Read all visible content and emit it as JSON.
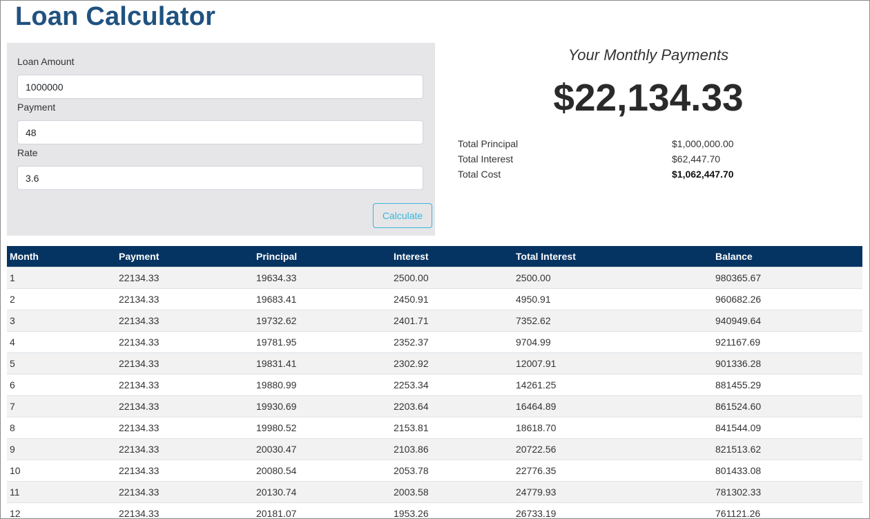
{
  "page": {
    "title": "Loan Calculator"
  },
  "form": {
    "loan_amount_label": "Loan Amount",
    "loan_amount_value": "1000000",
    "payment_label": "Payment",
    "payment_value": "48",
    "rate_label": "Rate",
    "rate_value": "3.6",
    "calculate_label": "Calculate"
  },
  "results": {
    "heading": "Your Monthly Payments",
    "monthly_payment": "$22,134.33",
    "summary": [
      {
        "label": "Total Principal",
        "value": "$1,000,000.00"
      },
      {
        "label": "Total Interest",
        "value": "$62,447.70"
      },
      {
        "label": "Total Cost",
        "value": "$1,062,447.70"
      }
    ]
  },
  "table": {
    "headers": [
      "Month",
      "Payment",
      "Principal",
      "Interest",
      "Total Interest",
      "Balance"
    ],
    "rows": [
      [
        "1",
        "22134.33",
        "19634.33",
        "2500.00",
        "2500.00",
        "980365.67"
      ],
      [
        "2",
        "22134.33",
        "19683.41",
        "2450.91",
        "4950.91",
        "960682.26"
      ],
      [
        "3",
        "22134.33",
        "19732.62",
        "2401.71",
        "7352.62",
        "940949.64"
      ],
      [
        "4",
        "22134.33",
        "19781.95",
        "2352.37",
        "9704.99",
        "921167.69"
      ],
      [
        "5",
        "22134.33",
        "19831.41",
        "2302.92",
        "12007.91",
        "901336.28"
      ],
      [
        "6",
        "22134.33",
        "19880.99",
        "2253.34",
        "14261.25",
        "881455.29"
      ],
      [
        "7",
        "22134.33",
        "19930.69",
        "2203.64",
        "16464.89",
        "861524.60"
      ],
      [
        "8",
        "22134.33",
        "19980.52",
        "2153.81",
        "18618.70",
        "841544.09"
      ],
      [
        "9",
        "22134.33",
        "20030.47",
        "2103.86",
        "20722.56",
        "821513.62"
      ],
      [
        "10",
        "22134.33",
        "20080.54",
        "2053.78",
        "22776.35",
        "801433.08"
      ],
      [
        "11",
        "22134.33",
        "20130.74",
        "2003.58",
        "24779.93",
        "781302.33"
      ],
      [
        "12",
        "22134.33",
        "20181.07",
        "1953.26",
        "26733.19",
        "761121.26"
      ]
    ]
  }
}
